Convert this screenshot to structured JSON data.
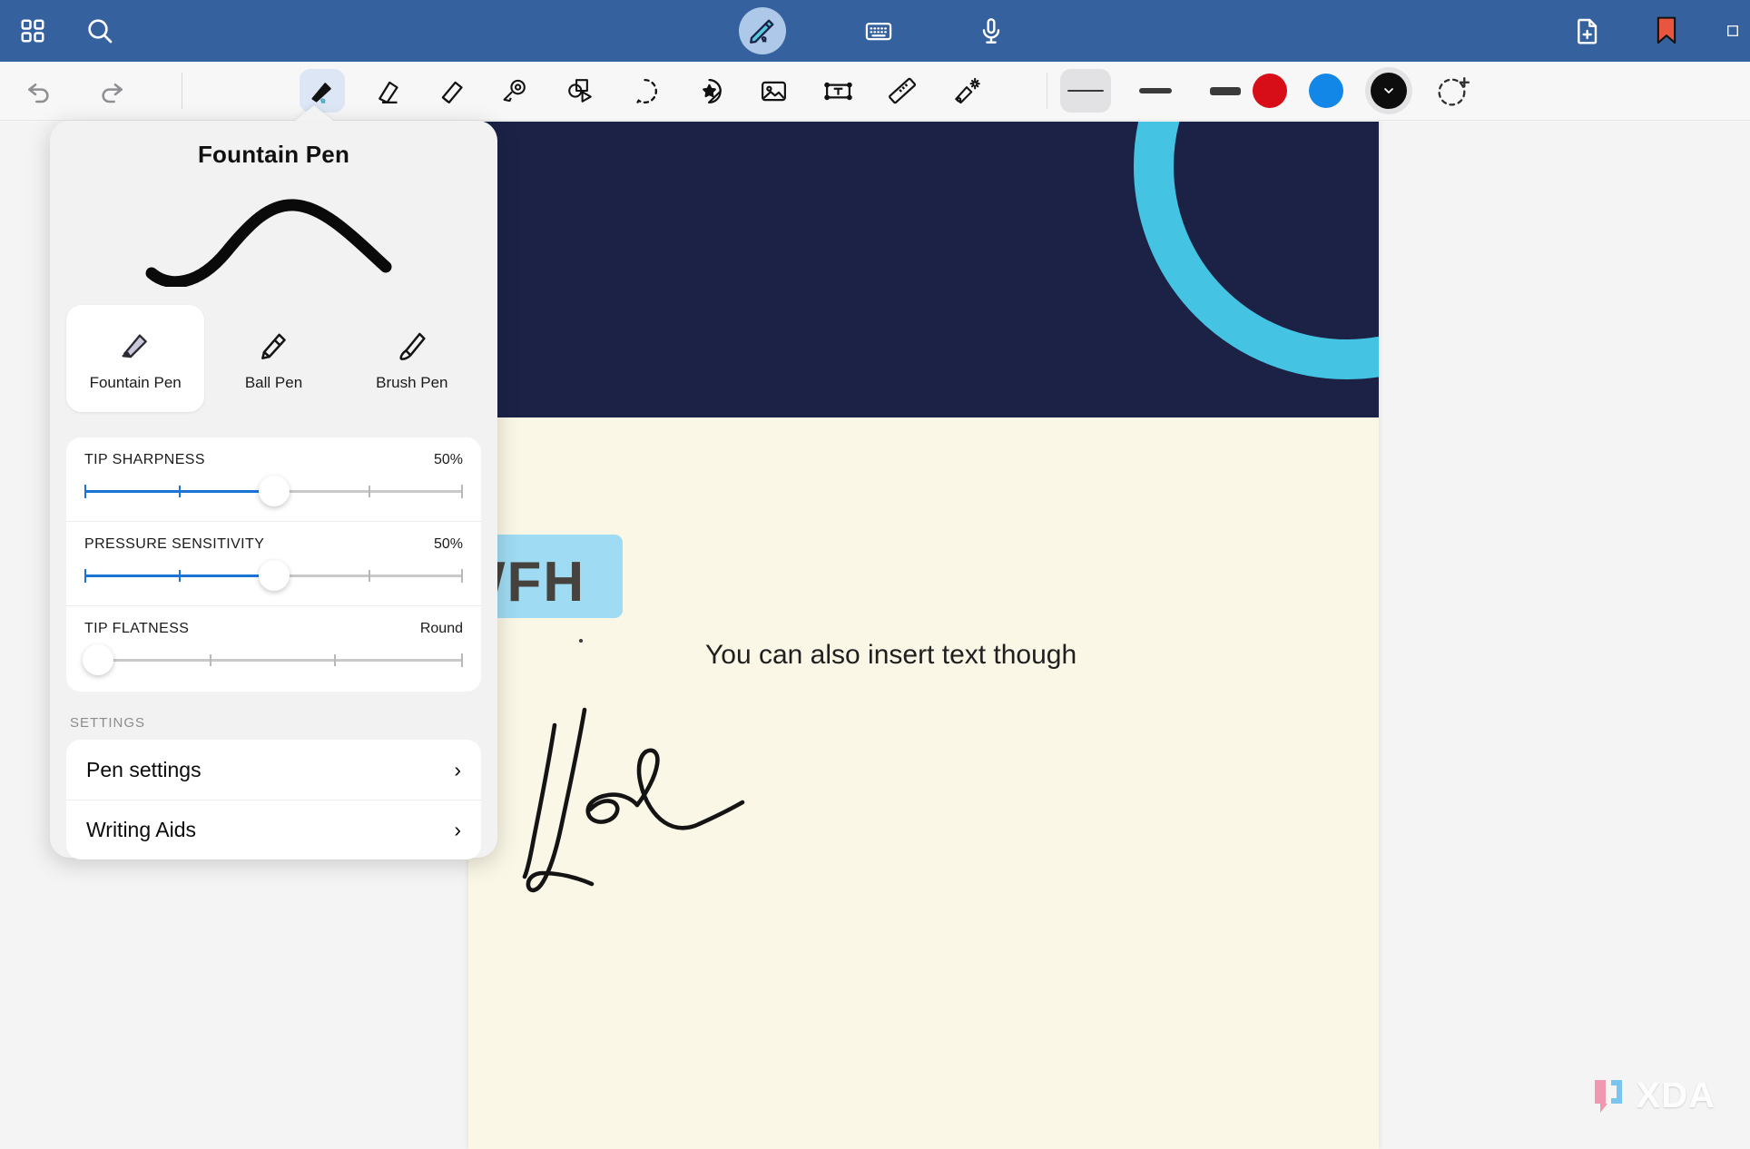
{
  "topbar": {
    "background_color": "#35629f",
    "left_icons": [
      {
        "name": "grid-icon",
        "label": "Grid view"
      },
      {
        "name": "search-icon",
        "label": "Search"
      }
    ],
    "center_icons": [
      {
        "name": "pen-mode-icon",
        "label": "Pen",
        "active": true
      },
      {
        "name": "keyboard-icon",
        "label": "Keyboard"
      },
      {
        "name": "microphone-icon",
        "label": "Voice recording"
      }
    ],
    "right_icons": [
      {
        "name": "add-page-icon",
        "label": "Add page"
      },
      {
        "name": "bookmark-icon",
        "label": "Bookmark",
        "color": "#e8563f"
      }
    ]
  },
  "toolbar": {
    "undo_label": "Undo",
    "redo_label": "Redo",
    "tools": [
      {
        "name": "fountain-pen-tool",
        "label": "Pen",
        "selected": true
      },
      {
        "name": "eraser-tool",
        "label": "Eraser",
        "selected": false
      },
      {
        "name": "highlighter-tool",
        "label": "Highlighter",
        "selected": false
      },
      {
        "name": "lasso-shape-tool",
        "label": "Shape recognition",
        "selected": false
      },
      {
        "name": "shapes-tool",
        "label": "Shapes",
        "selected": false
      },
      {
        "name": "lasso-select-tool",
        "label": "Lasso select",
        "selected": false
      },
      {
        "name": "sticker-tool",
        "label": "Sticker",
        "selected": false
      },
      {
        "name": "image-tool",
        "label": "Insert image",
        "selected": false
      },
      {
        "name": "text-tool",
        "label": "Text box",
        "selected": false
      },
      {
        "name": "ruler-tool",
        "label": "Ruler",
        "selected": false
      },
      {
        "name": "magic-eraser-tool",
        "label": "Magic eraser",
        "selected": false
      }
    ],
    "strokes": [
      {
        "name": "stroke-thin",
        "label": "Thin",
        "selected": true,
        "thickness": 2
      },
      {
        "name": "stroke-medium",
        "label": "Medium",
        "selected": false,
        "thickness": 6
      },
      {
        "name": "stroke-thick",
        "label": "Thick",
        "selected": false,
        "thickness": 9
      }
    ],
    "colors": [
      {
        "name": "color-red",
        "hex": "#d70d17",
        "selected": false
      },
      {
        "name": "color-blue",
        "hex": "#1387e8",
        "selected": false
      },
      {
        "name": "color-black",
        "hex": "#0d0d0d",
        "selected": true
      }
    ],
    "add_color_label": "Add color"
  },
  "panel": {
    "title": "Fountain Pen",
    "preview_label": "Stroke preview",
    "pen_types": [
      {
        "name": "fountain-pen",
        "label": "Fountain Pen",
        "selected": true
      },
      {
        "name": "ball-pen",
        "label": "Ball Pen",
        "selected": false
      },
      {
        "name": "brush-pen",
        "label": "Brush Pen",
        "selected": false
      }
    ],
    "sliders": [
      {
        "name": "tip-sharpness",
        "label": "TIP SHARPNESS",
        "value_text": "50%",
        "percent": 50,
        "filled": true
      },
      {
        "name": "pressure-sensitivity",
        "label": "PRESSURE SENSITIVITY",
        "value_text": "50%",
        "percent": 50,
        "filled": true
      },
      {
        "name": "tip-flatness",
        "label": "TIP FLATNESS",
        "value_text": "Round",
        "percent": 0,
        "filled": false
      }
    ],
    "settings_header": "SETTINGS",
    "settings_rows": [
      {
        "name": "pen-settings",
        "label": "Pen settings",
        "chevron": "›"
      },
      {
        "name": "writing-aids",
        "label": "Writing Aids",
        "chevron": "›"
      }
    ]
  },
  "canvas": {
    "page_background": "#faf7e6",
    "header_background": "#1b2246",
    "arc_color": "#44c4e2",
    "highlight_color": "#9fdbf2",
    "heading_text": "WFH",
    "body_text": "You can also insert text though",
    "handwriting_label": "Handwritten ink stroke"
  },
  "watermark": {
    "text": "XDA",
    "bracket_left_color": "#f08fa8",
    "bracket_right_color": "#6cc0f0"
  }
}
